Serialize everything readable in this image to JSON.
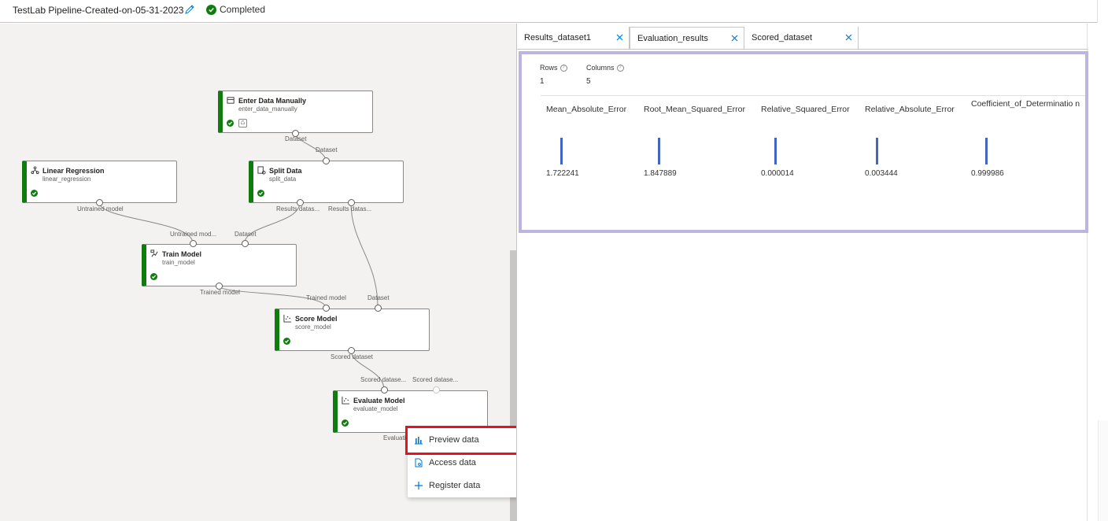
{
  "header": {
    "title": "TestLab Pipeline-Created-on-05-31-2023",
    "status": "Completed"
  },
  "nodes": {
    "enter": {
      "title": "Enter Data Manually",
      "sub": "enter_data_manually",
      "out": "Dataset"
    },
    "linear": {
      "title": "Linear Regression",
      "sub": "linear_regression",
      "out": "Untrained model"
    },
    "split": {
      "title": "Split Data",
      "sub": "split_data",
      "in": "Dataset",
      "out1": "Results datas...",
      "out2": "Results datas..."
    },
    "train": {
      "title": "Train Model",
      "sub": "train_model",
      "in1": "Untrained mod...",
      "in2": "Dataset",
      "out": "Trained model"
    },
    "score": {
      "title": "Score Model",
      "sub": "score_model",
      "in1": "Trained model",
      "in2": "Dataset",
      "out": "Scored dataset"
    },
    "evaluate": {
      "title": "Evaluate Model",
      "sub": "evaluate_model",
      "in1": "Scored datase...",
      "in2": "Scored datase...",
      "out": "Evaluati"
    }
  },
  "context_menu": {
    "items": [
      {
        "label": "Preview data",
        "icon": "bar-chart-icon"
      },
      {
        "label": "Access data",
        "icon": "document-icon"
      },
      {
        "label": "Register data",
        "icon": "plus-icon"
      }
    ]
  },
  "tabs": [
    {
      "label": "Results_dataset1"
    },
    {
      "label": "Evaluation_results"
    },
    {
      "label": "Scored_dataset"
    }
  ],
  "results": {
    "rows_label": "Rows",
    "rows_value": "1",
    "columns_label": "Columns",
    "columns_value": "5",
    "columns": [
      {
        "name": "Mean_Absolute_Error",
        "value": "1.722241"
      },
      {
        "name": "Root_Mean_Squared_Error",
        "value": "1.847889"
      },
      {
        "name": "Relative_Squared_Error",
        "value": "0.000014"
      },
      {
        "name": "Relative_Absolute_Error",
        "value": "0.003444"
      },
      {
        "name": "Coefficient_of_Determinatio n",
        "value": "0.999986"
      }
    ]
  },
  "colors": {
    "accent": "#0078d4",
    "success": "#107c10",
    "highlight": "#e81123",
    "panel_border": "#bdb5df",
    "bar": "#4264c4"
  }
}
